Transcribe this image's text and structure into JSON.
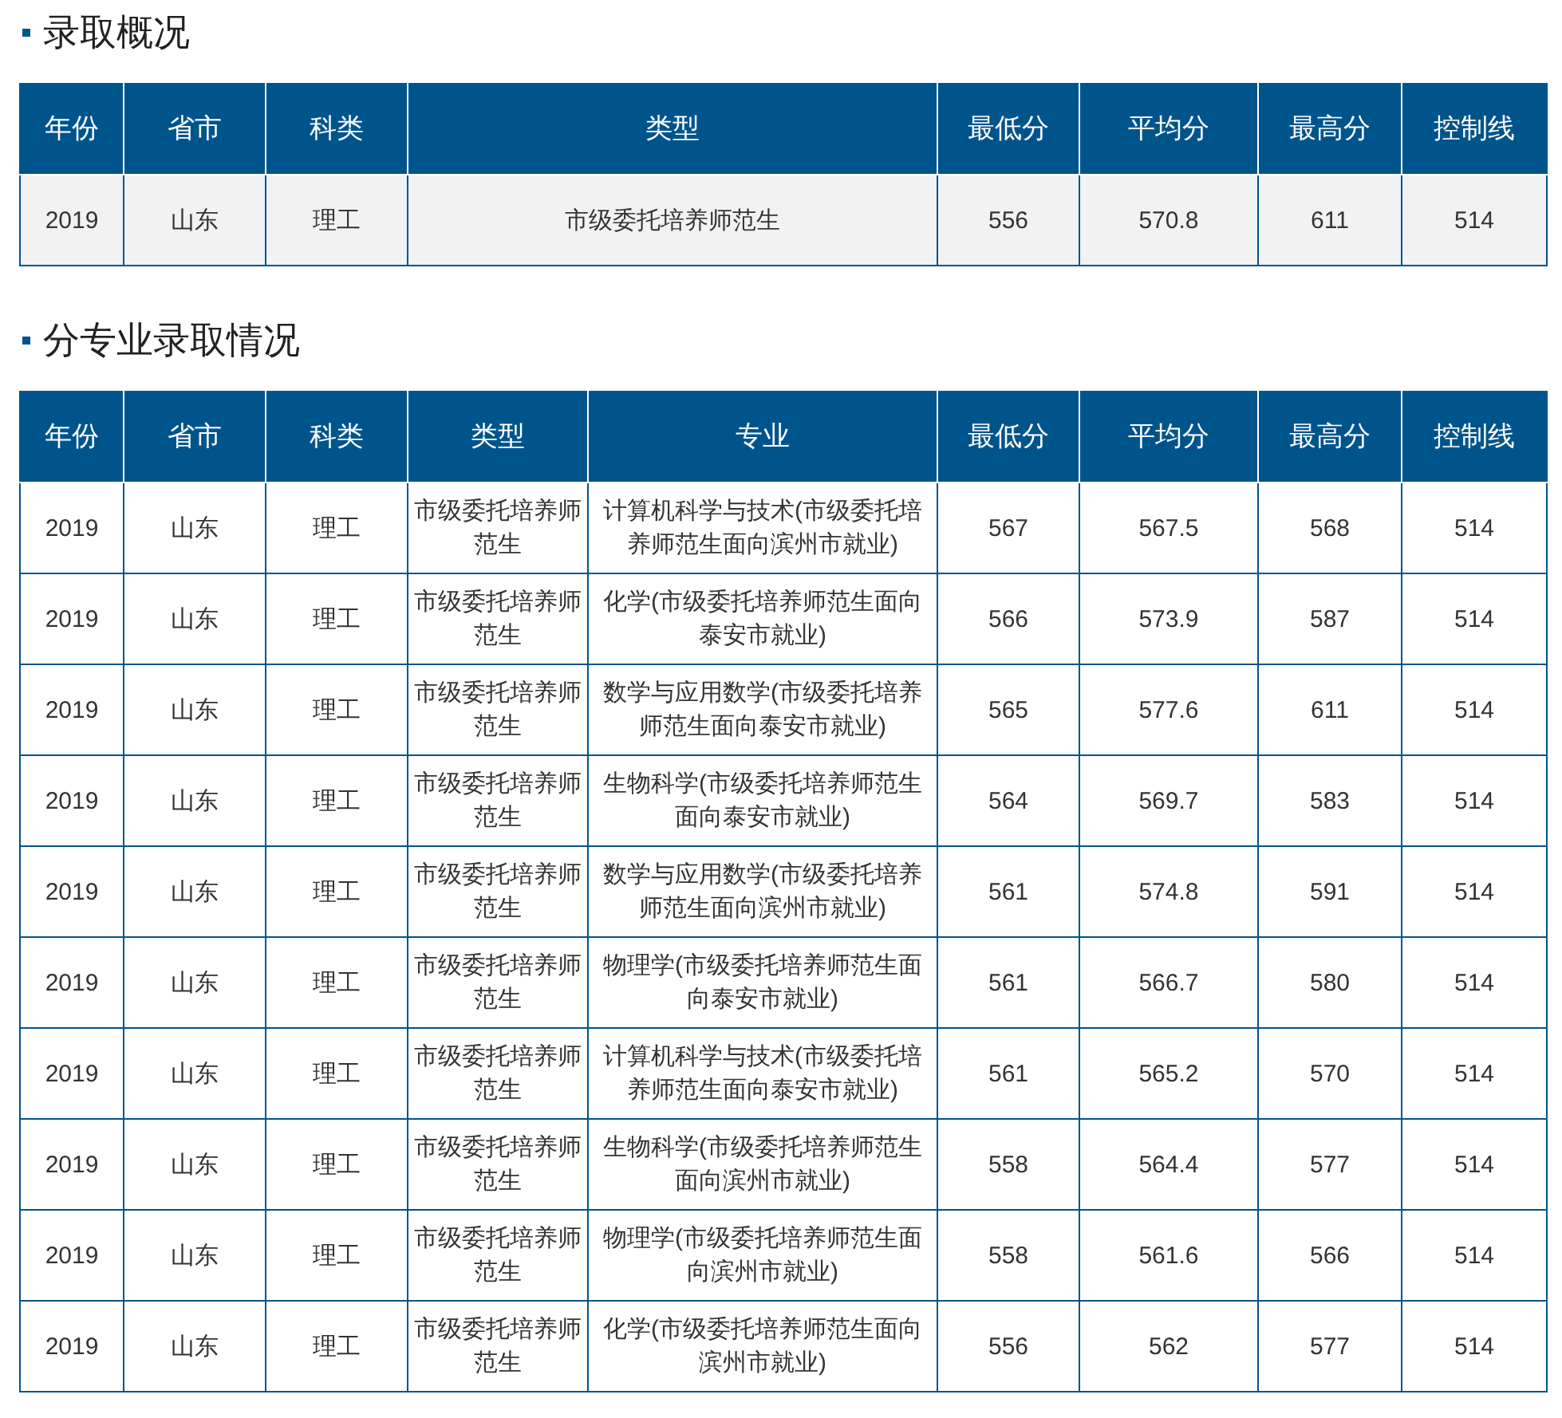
{
  "sections": [
    {
      "kind": "summary",
      "title": "录取概况",
      "table": {
        "columns": [
          "年份",
          "省市",
          "科类",
          "类型",
          "最低分",
          "平均分",
          "最高分",
          "控制线"
        ],
        "rows": [
          [
            "2019",
            "山东",
            "理工",
            "市级委托培养师范生",
            "556",
            "570.8",
            "611",
            "514"
          ]
        ]
      }
    },
    {
      "kind": "detail",
      "title": "分专业录取情况",
      "table": {
        "columns": [
          "年份",
          "省市",
          "科类",
          "类型",
          "专业",
          "最低分",
          "平均分",
          "最高分",
          "控制线"
        ],
        "rows": [
          [
            "2019",
            "山东",
            "理工",
            "市级委托培养师范生",
            "计算机科学与技术(市级委托培养师范生面向滨州市就业)",
            "567",
            "567.5",
            "568",
            "514"
          ],
          [
            "2019",
            "山东",
            "理工",
            "市级委托培养师范生",
            "化学(市级委托培养师范生面向泰安市就业)",
            "566",
            "573.9",
            "587",
            "514"
          ],
          [
            "2019",
            "山东",
            "理工",
            "市级委托培养师范生",
            "数学与应用数学(市级委托培养师范生面向泰安市就业)",
            "565",
            "577.6",
            "611",
            "514"
          ],
          [
            "2019",
            "山东",
            "理工",
            "市级委托培养师范生",
            "生物科学(市级委托培养师范生面向泰安市就业)",
            "564",
            "569.7",
            "583",
            "514"
          ],
          [
            "2019",
            "山东",
            "理工",
            "市级委托培养师范生",
            "数学与应用数学(市级委托培养师范生面向滨州市就业)",
            "561",
            "574.8",
            "591",
            "514"
          ],
          [
            "2019",
            "山东",
            "理工",
            "市级委托培养师范生",
            "物理学(市级委托培养师范生面向泰安市就业)",
            "561",
            "566.7",
            "580",
            "514"
          ],
          [
            "2019",
            "山东",
            "理工",
            "市级委托培养师范生",
            "计算机科学与技术(市级委托培养师范生面向泰安市就业)",
            "561",
            "565.2",
            "570",
            "514"
          ],
          [
            "2019",
            "山东",
            "理工",
            "市级委托培养师范生",
            "生物科学(市级委托培养师范生面向滨州市就业)",
            "558",
            "564.4",
            "577",
            "514"
          ],
          [
            "2019",
            "山东",
            "理工",
            "市级委托培养师范生",
            "物理学(市级委托培养师范生面向滨州市就业)",
            "558",
            "561.6",
            "566",
            "514"
          ],
          [
            "2019",
            "山东",
            "理工",
            "市级委托培养师范生",
            "化学(市级委托培养师范生面向滨州市就业)",
            "556",
            "562",
            "577",
            "514"
          ]
        ]
      }
    }
  ]
}
